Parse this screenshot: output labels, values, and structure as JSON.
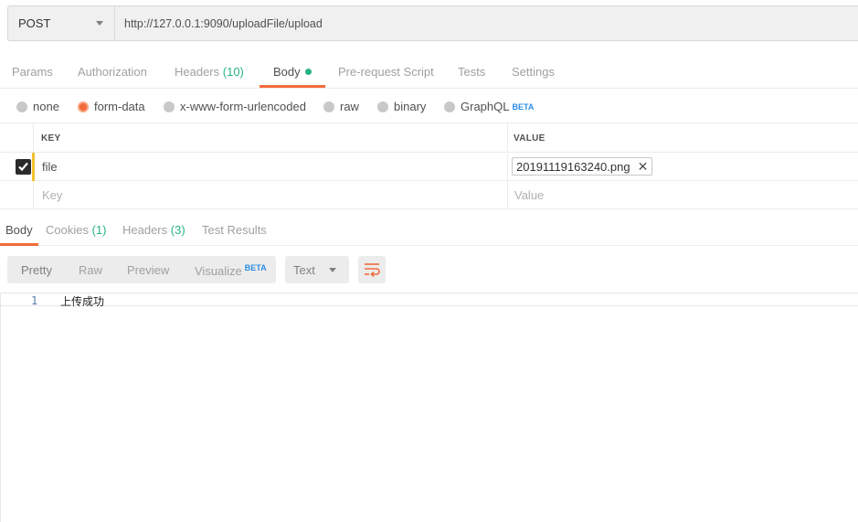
{
  "request": {
    "method": "POST",
    "url": "http://127.0.0.1:9090/uploadFile/upload"
  },
  "request_tabs": {
    "params": "Params",
    "authorization": "Authorization",
    "headers": "Headers",
    "headers_count": "(10)",
    "body": "Body",
    "pre_request_script": "Pre-request Script",
    "tests": "Tests",
    "settings": "Settings",
    "active": "Body"
  },
  "body_types": {
    "none": "none",
    "form_data": "form-data",
    "urlencoded": "x-www-form-urlencoded",
    "raw": "raw",
    "binary": "binary",
    "graphql": "GraphQL",
    "graphql_badge": "BETA",
    "selected": "form-data"
  },
  "params_table": {
    "key_header": "KEY",
    "value_header": "VALUE",
    "rows": [
      {
        "checked": true,
        "key": "file",
        "value": "20191119163240.png"
      }
    ],
    "placeholder_key": "Key",
    "placeholder_value": "Value"
  },
  "response_tabs": {
    "body": "Body",
    "cookies": "Cookies",
    "cookies_count": "(1)",
    "headers": "Headers",
    "headers_count": "(3)",
    "test_results": "Test Results",
    "active": "Body"
  },
  "response_toolbar": {
    "pretty": "Pretty",
    "raw": "Raw",
    "preview": "Preview",
    "visualize": "Visualize",
    "visualize_badge": "BETA",
    "format": "Text",
    "active_view": "Pretty"
  },
  "response_body": {
    "lines": [
      {
        "number": "1",
        "text": "上传成功"
      }
    ]
  },
  "colors": {
    "accent": "#f26b3a",
    "count_green": "#26b47f",
    "beta_blue": "#2d8ee6",
    "row_highlight": "#f2c12e"
  }
}
